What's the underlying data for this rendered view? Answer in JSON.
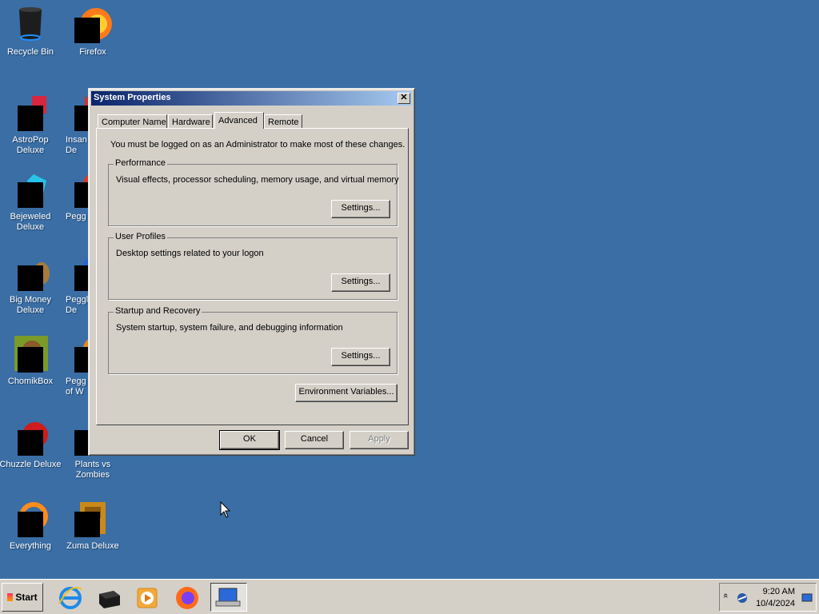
{
  "desktop": {
    "icons": [
      {
        "label": "Recycle Bin"
      },
      {
        "label": "Firefox"
      },
      {
        "label": "AstroPop\nDeluxe"
      },
      {
        "label": "Insan\nDe"
      },
      {
        "label": "Bejeweled\nDeluxe"
      },
      {
        "label": "Pegg"
      },
      {
        "label": "Big Money\nDeluxe"
      },
      {
        "label": "Peggl\nDe"
      },
      {
        "label": "ChomikBox"
      },
      {
        "label": "Pegg\nof W"
      },
      {
        "label": "Chuzzle Deluxe"
      },
      {
        "label": "Plants vs\nZombies"
      },
      {
        "label": "Everything"
      },
      {
        "label": "Zuma Deluxe"
      }
    ]
  },
  "dialog": {
    "title": "System Properties",
    "close_glyph": "✕",
    "tabs": [
      {
        "label": "Computer Name"
      },
      {
        "label": "Hardware"
      },
      {
        "label": "Advanced"
      },
      {
        "label": "Remote"
      }
    ],
    "active_tab": "Advanced",
    "admin_note": "You must be logged on as an Administrator to make most of these changes.",
    "performance": {
      "label": "Performance",
      "description": "Visual effects, processor scheduling, memory usage, and virtual memory",
      "button": "Settings..."
    },
    "user_profiles": {
      "label": "User Profiles",
      "description": "Desktop settings related to your logon",
      "button": "Settings..."
    },
    "startup_recovery": {
      "label": "Startup and Recovery",
      "description": "System startup, system failure, and debugging information",
      "button": "Settings..."
    },
    "env_button": "Environment Variables...",
    "ok": "OK",
    "cancel": "Cancel",
    "apply": "Apply"
  },
  "taskbar": {
    "start_label": "Start",
    "tray_expand": "«",
    "time": "9:20 AM",
    "date": "10/4/2024"
  }
}
